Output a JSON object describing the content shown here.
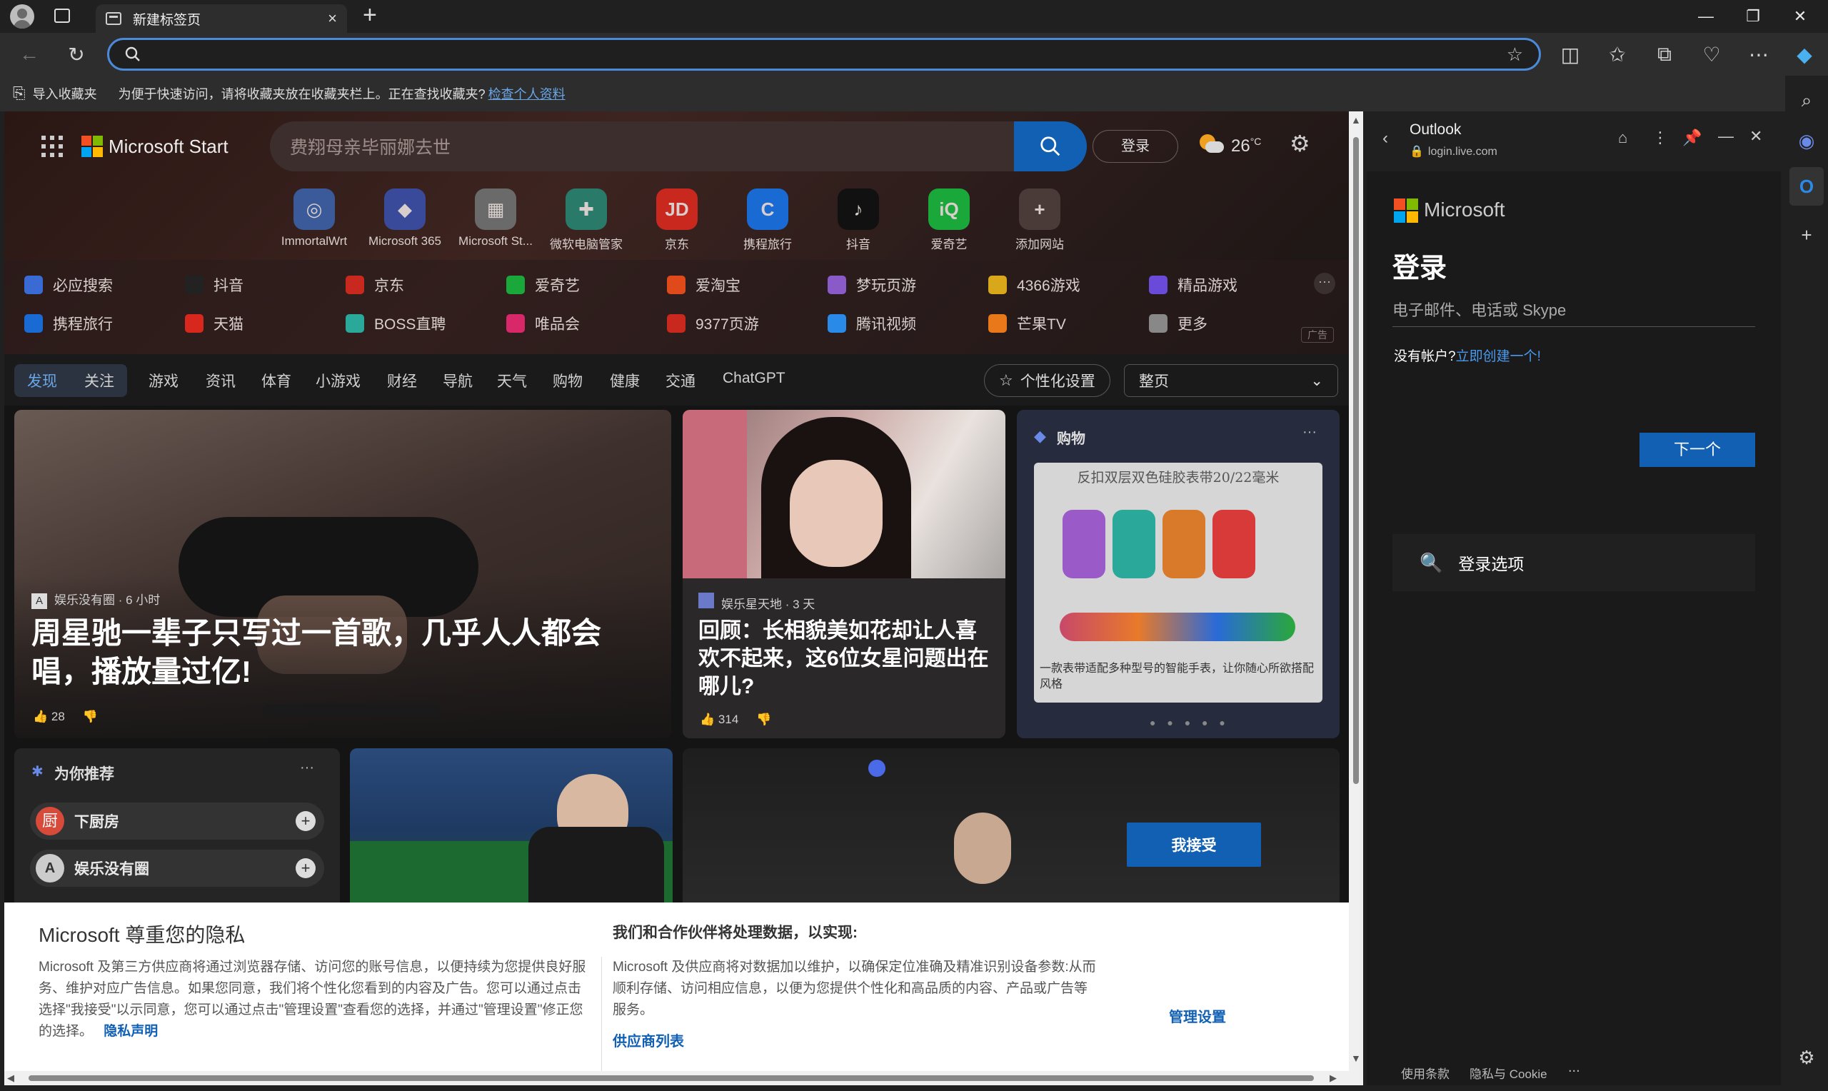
{
  "browser": {
    "tab_title": "新建标签页",
    "new_tab": "+",
    "address_value": "",
    "favbar": {
      "import": "导入收藏夹",
      "message": "为便于快速访问，请将收藏夹放在收藏夹栏上。正在查找收藏夹?",
      "link": "检查个人资料"
    }
  },
  "msn": {
    "brand": "Microsoft Start",
    "search_placeholder": "费翔母亲毕丽娜去世",
    "login": "登录",
    "weather": "26",
    "weather_unit": "°C",
    "quicklinks": [
      {
        "label": "ImmortalWrt",
        "glyph": "◎",
        "color": "#3a5a9a"
      },
      {
        "label": "Microsoft 365",
        "glyph": "◆",
        "color": "#3a4a9a"
      },
      {
        "label": "Microsoft St...",
        "glyph": "▦",
        "color": "#6a6a6a"
      },
      {
        "label": "微软电脑管家",
        "glyph": "✚",
        "color": "#2a7a6a"
      },
      {
        "label": "京东",
        "glyph": "JD",
        "color": "#c8281e"
      },
      {
        "label": "携程旅行",
        "glyph": "C",
        "color": "#1a6ad4"
      },
      {
        "label": "抖音",
        "glyph": "♪",
        "color": "#111111"
      },
      {
        "label": "爱奇艺",
        "glyph": "iQ",
        "color": "#1aa83a"
      },
      {
        "label": "添加网站",
        "glyph": "+",
        "color": "#4a3a38"
      }
    ],
    "linkgrid": [
      {
        "label": "必应搜索",
        "color": "#3a6ad4"
      },
      {
        "label": "抖音",
        "color": "#222222"
      },
      {
        "label": "京东",
        "color": "#c8281e"
      },
      {
        "label": "爱奇艺",
        "color": "#1aa83a"
      },
      {
        "label": "爱淘宝",
        "color": "#e04a1a"
      },
      {
        "label": "梦玩页游",
        "color": "#8a5ac8"
      },
      {
        "label": "4366游戏",
        "color": "#d8a81a"
      },
      {
        "label": "精品游戏",
        "color": "#6a4ad8"
      },
      {
        "label": "携程旅行",
        "color": "#1a6ad4"
      },
      {
        "label": "天猫",
        "color": "#d8281e"
      },
      {
        "label": "BOSS直聘",
        "color": "#2aa89a"
      },
      {
        "label": "唯品会",
        "color": "#d8286a"
      },
      {
        "label": "9377页游",
        "color": "#c8281e"
      },
      {
        "label": "腾讯视频",
        "color": "#2a8ae8"
      },
      {
        "label": "芒果TV",
        "color": "#e8781a"
      },
      {
        "label": "更多",
        "color": "#888888"
      }
    ],
    "ad_label": "广告",
    "nav": [
      "发现",
      "关注",
      "游戏",
      "资讯",
      "体育",
      "小游戏",
      "财经",
      "导航",
      "天气",
      "购物",
      "健康",
      "交通",
      "ChatGPT"
    ],
    "personalize": "个性化设置",
    "layout_select": "整页",
    "hero": {
      "source": "娱乐没有圈 · 6 小时",
      "title": "周星驰一辈子只写过一首歌，几乎人人都会唱，播放量过亿!",
      "likes": "28"
    },
    "card2": {
      "source": "娱乐星天地 · 3 天",
      "title": "回顾：长相貌美如花却让人喜欢不起来，这6位女星问题出在哪儿?",
      "likes": "314"
    },
    "card3": {
      "label": "购物",
      "product_title": "反扣双层双色硅胶表带20/22毫米",
      "caption": "一款表带适配多种型号的智能手表，让你随心所欲搭配风格"
    },
    "recommend": {
      "title": "为你推荐",
      "items": [
        "下厨房",
        "娱乐没有圈"
      ]
    }
  },
  "privacy": {
    "title": "Microsoft 尊重您的隐私",
    "body": "Microsoft 及第三方供应商将通过浏览器存储、访问您的账号信息，以便持续为您提供良好服务、维护对应广告信息。如果您同意，我们将个性化您看到的内容及广告。您可以通过点击选择\"我接受\"以示同意，您可以通过点击\"管理设置\"查看您的选择，并通过\"管理设置\"修正您的选择。",
    "privacy_link": "隐私声明",
    "title2": "我们和合作伙伴将处理数据，以实现:",
    "body2": "Microsoft 及供应商将对数据加以维护，以确保定位准确及精准识别设备参数:从而顺利存储、访问相应信息，以便为您提供个性化和高品质的内容、产品或广告等服务。",
    "vendor_link": "供应商列表",
    "accept": "我接受",
    "manage": "管理设置"
  },
  "panel": {
    "title": "Outlook",
    "url": "login.live.com",
    "brand": "Microsoft",
    "heading": "登录",
    "email_placeholder": "电子邮件、电话或 Skype",
    "no_account": "没有帐户?",
    "create_link": "立即创建一个!",
    "next": "下一个",
    "signin_options": "登录选项",
    "terms": "使用条款",
    "privacy": "隐私与 Cookie",
    "more": "..."
  }
}
